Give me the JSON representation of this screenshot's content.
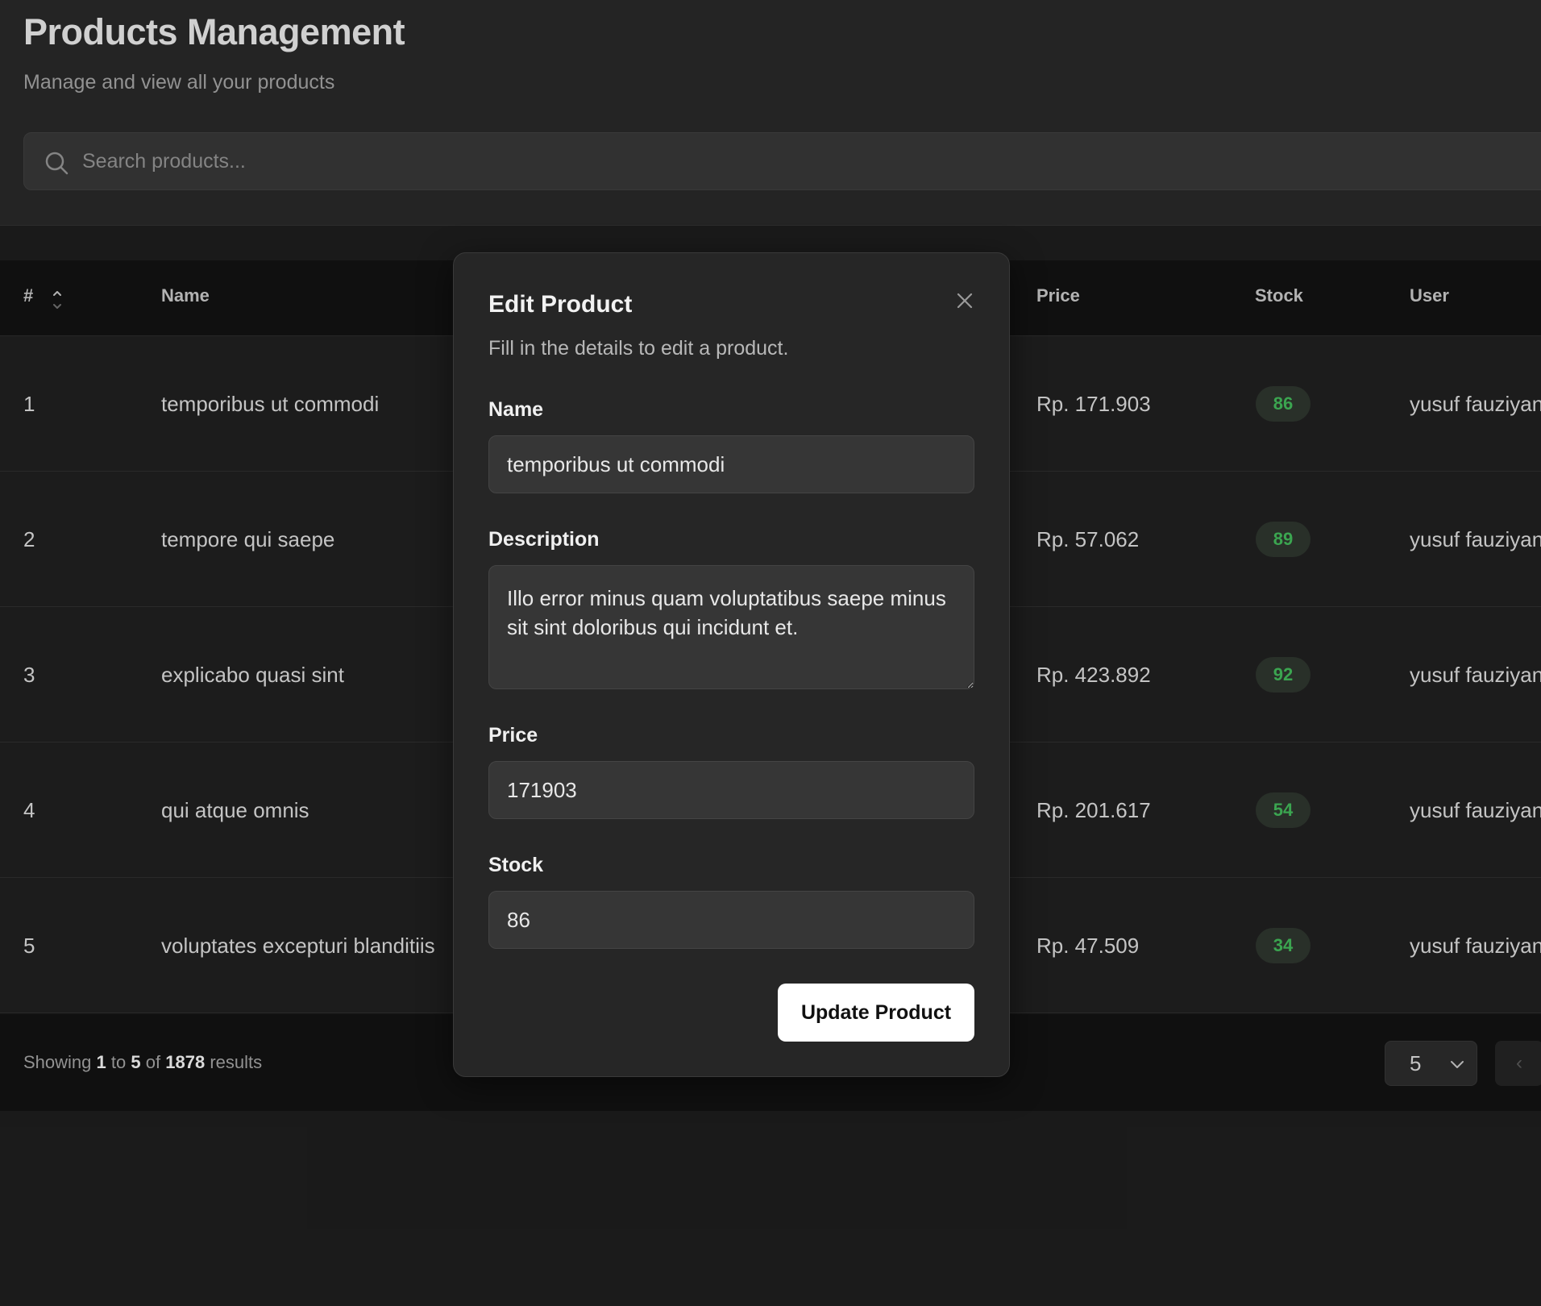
{
  "header": {
    "title": "Products Management",
    "subtitle": "Manage and view all your products",
    "search_placeholder": "Search products..."
  },
  "table": {
    "columns": {
      "index": "#",
      "name": "Name",
      "price": "Price",
      "stock": "Stock",
      "user": "User"
    },
    "rows": [
      {
        "index": "1",
        "name": "temporibus ut commodi",
        "price": "Rp. 171.903",
        "stock": "86",
        "user": "yusuf fauziyan"
      },
      {
        "index": "2",
        "name": "tempore qui saepe",
        "price": "Rp. 57.062",
        "stock": "89",
        "user": "yusuf fauziyan"
      },
      {
        "index": "3",
        "name": "explicabo quasi sint",
        "price": "Rp. 423.892",
        "stock": "92",
        "user": "yusuf fauziyan"
      },
      {
        "index": "4",
        "name": "qui atque omnis",
        "price": "Rp. 201.617",
        "stock": "54",
        "user": "yusuf fauziyan"
      },
      {
        "index": "5",
        "name": "voluptates excepturi blanditiis",
        "price": "Rp. 47.509",
        "stock": "34",
        "user": "yusuf fauziyan"
      }
    ]
  },
  "footer": {
    "showing_prefix": "Showing",
    "from": "1",
    "to_word": "to",
    "to": "5",
    "of_word": "of",
    "total": "1878",
    "results_word": "results",
    "per_page": "5",
    "prev_label": "‹"
  },
  "modal": {
    "title": "Edit Product",
    "description": "Fill in the details to edit a product.",
    "name_label": "Name",
    "name_value": "temporibus ut commodi",
    "description_label": "Description",
    "description_value": "Illo error minus quam voluptatibus saepe minus sit sint doloribus qui incidunt et.",
    "price_label": "Price",
    "price_value": "171903",
    "stock_label": "Stock",
    "stock_value": "86",
    "submit_label": "Update Product"
  },
  "colors": {
    "stock_badge_text": "#3fae55",
    "primary_button": "#ffffff"
  }
}
